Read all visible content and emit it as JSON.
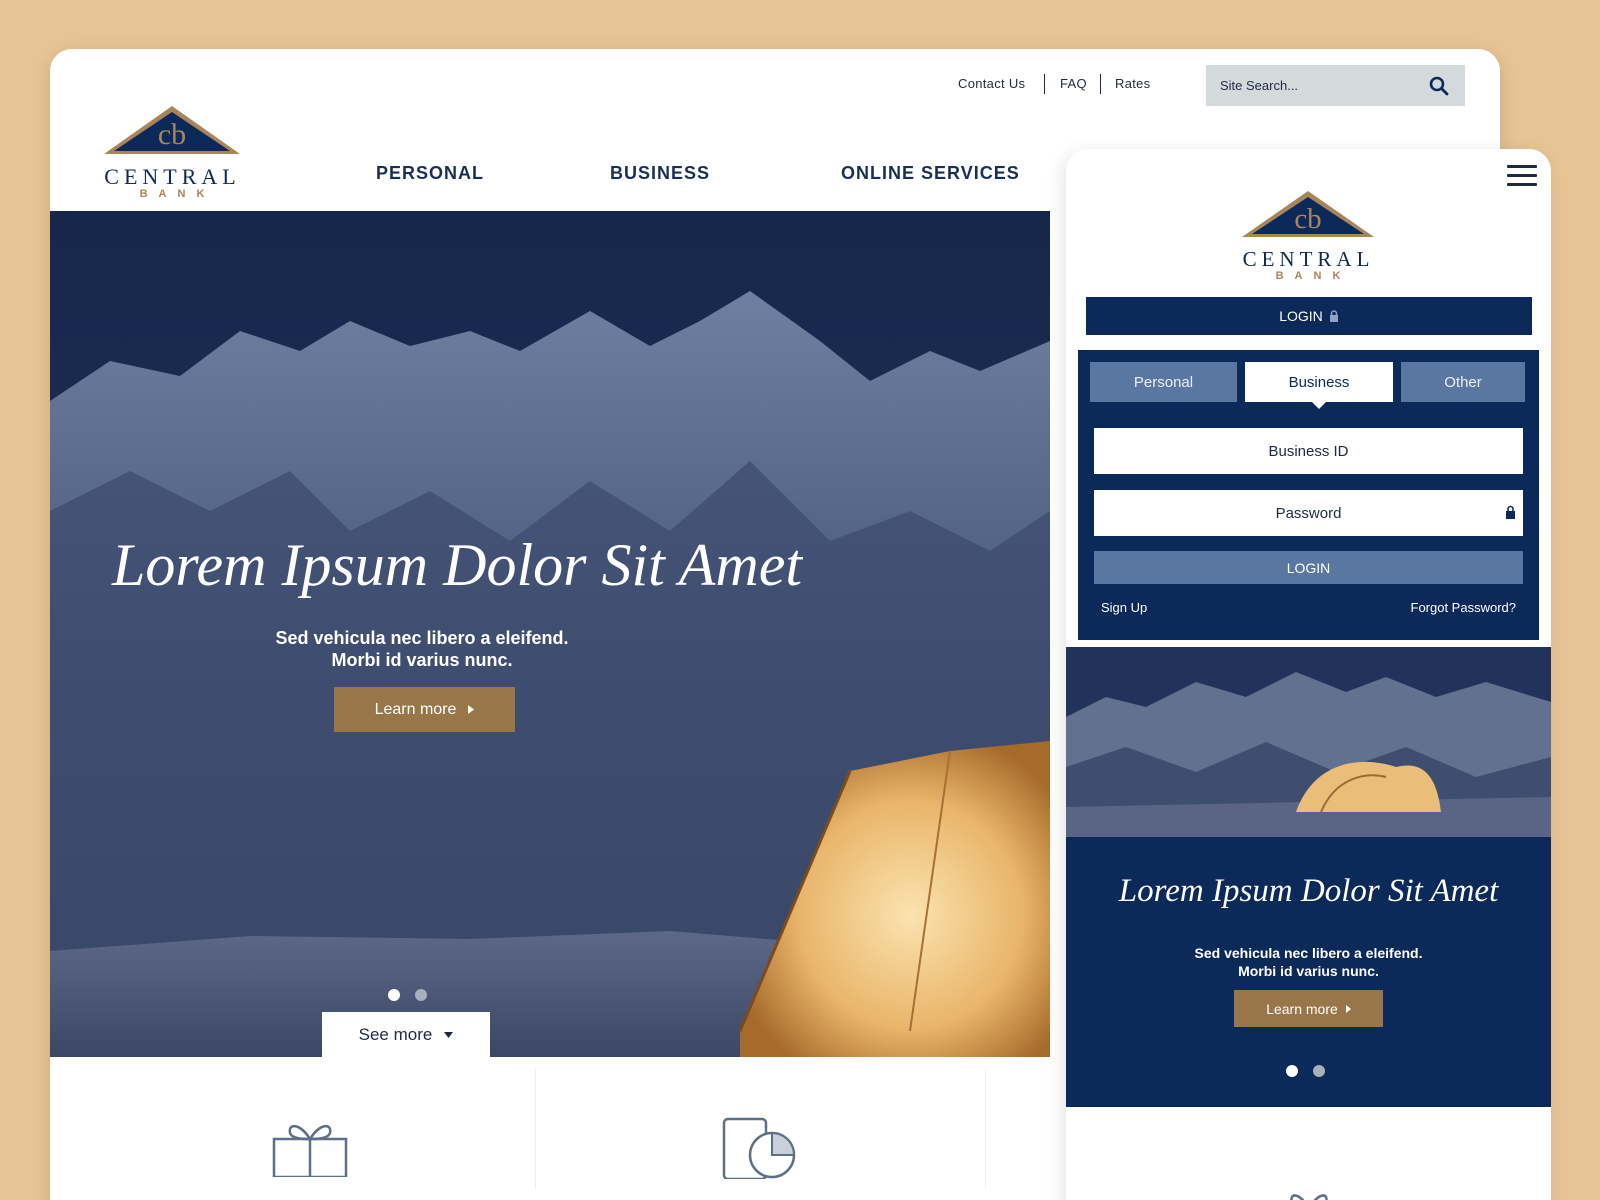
{
  "brand": {
    "name": "CENTRAL",
    "sub": "BANK",
    "monogram": "cb"
  },
  "colors": {
    "navy": "#0c2a59",
    "gold": "#98764a",
    "page_bg": "#e6c494",
    "tab_blue": "#5a77a1"
  },
  "desktop": {
    "utility_nav": [
      "Contact Us",
      "FAQ",
      "Rates"
    ],
    "search": {
      "placeholder": "Site Search...",
      "icon": "search-icon"
    },
    "main_nav": [
      "PERSONAL",
      "BUSINESS",
      "ONLINE SERVICES"
    ],
    "hero": {
      "title": "Lorem Ipsum Dolor Sit Amet",
      "subtitle_line1": "Sed vehicula nec libero a eleifend.",
      "subtitle_line2": "Morbi id varius nunc.",
      "cta": "Learn more",
      "slides": 2,
      "active_slide": 1,
      "see_more": "See more"
    },
    "feature_icons": [
      "gift-icon",
      "mobile-chart-icon"
    ]
  },
  "mobile": {
    "menu_icon": "hamburger-icon",
    "login_bar": "LOGIN",
    "tabs": [
      "Personal",
      "Business",
      "Other"
    ],
    "active_tab": "Business",
    "fields": {
      "id_placeholder": "Business ID",
      "password_placeholder": "Password"
    },
    "login_button": "LOGIN",
    "sign_up": "Sign Up",
    "forgot": "Forgot Password?",
    "hero": {
      "title": "Lorem Ipsum Dolor Sit Amet",
      "subtitle_line1": "Sed vehicula nec libero a eleifend.",
      "subtitle_line2": "Morbi id varius nunc.",
      "cta": "Learn more",
      "slides": 2,
      "active_slide": 1
    }
  }
}
